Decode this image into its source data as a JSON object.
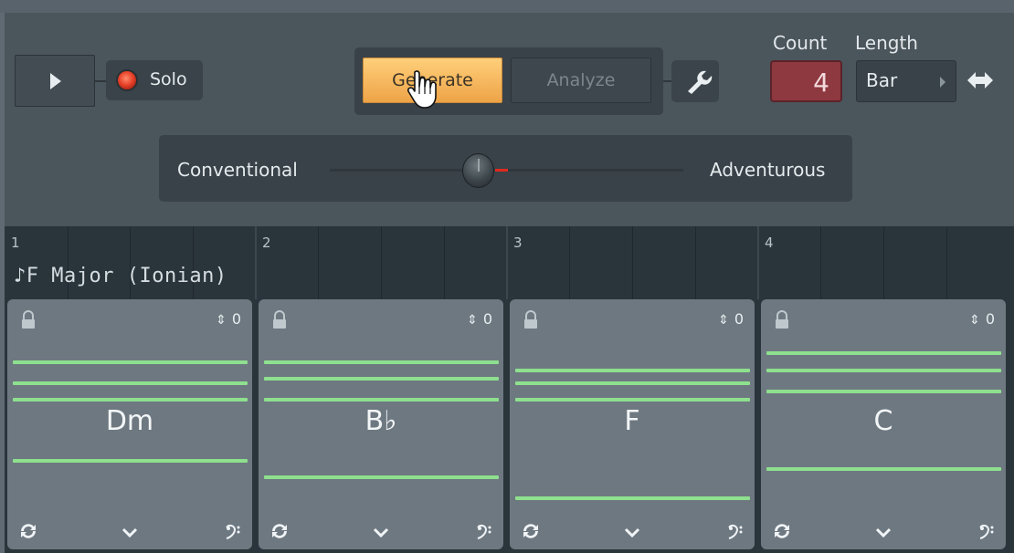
{
  "transport": {
    "solo_label": "Solo"
  },
  "toolbar": {
    "generate_label": "Generate",
    "analyze_label": "Analyze"
  },
  "count": {
    "label": "Count",
    "value": "4"
  },
  "length": {
    "label": "Length",
    "value": "Bar"
  },
  "slider": {
    "left_label": "Conventional",
    "right_label": "Adventurous",
    "value_fraction": 0.42
  },
  "timeline": {
    "bars": [
      "1",
      "2",
      "3",
      "4"
    ],
    "key_label": "♪F Major (Ionian)"
  },
  "chords": [
    {
      "name": "Dm",
      "inversion": "0"
    },
    {
      "name": "B♭",
      "inversion": "0"
    },
    {
      "name": "F",
      "inversion": "0"
    },
    {
      "name": "C",
      "inversion": "0"
    }
  ],
  "colors": {
    "accent_generate": "#eea347",
    "note": "#8ee08e",
    "count_bg": "#8e3840",
    "solo_led": "#e8432b"
  }
}
